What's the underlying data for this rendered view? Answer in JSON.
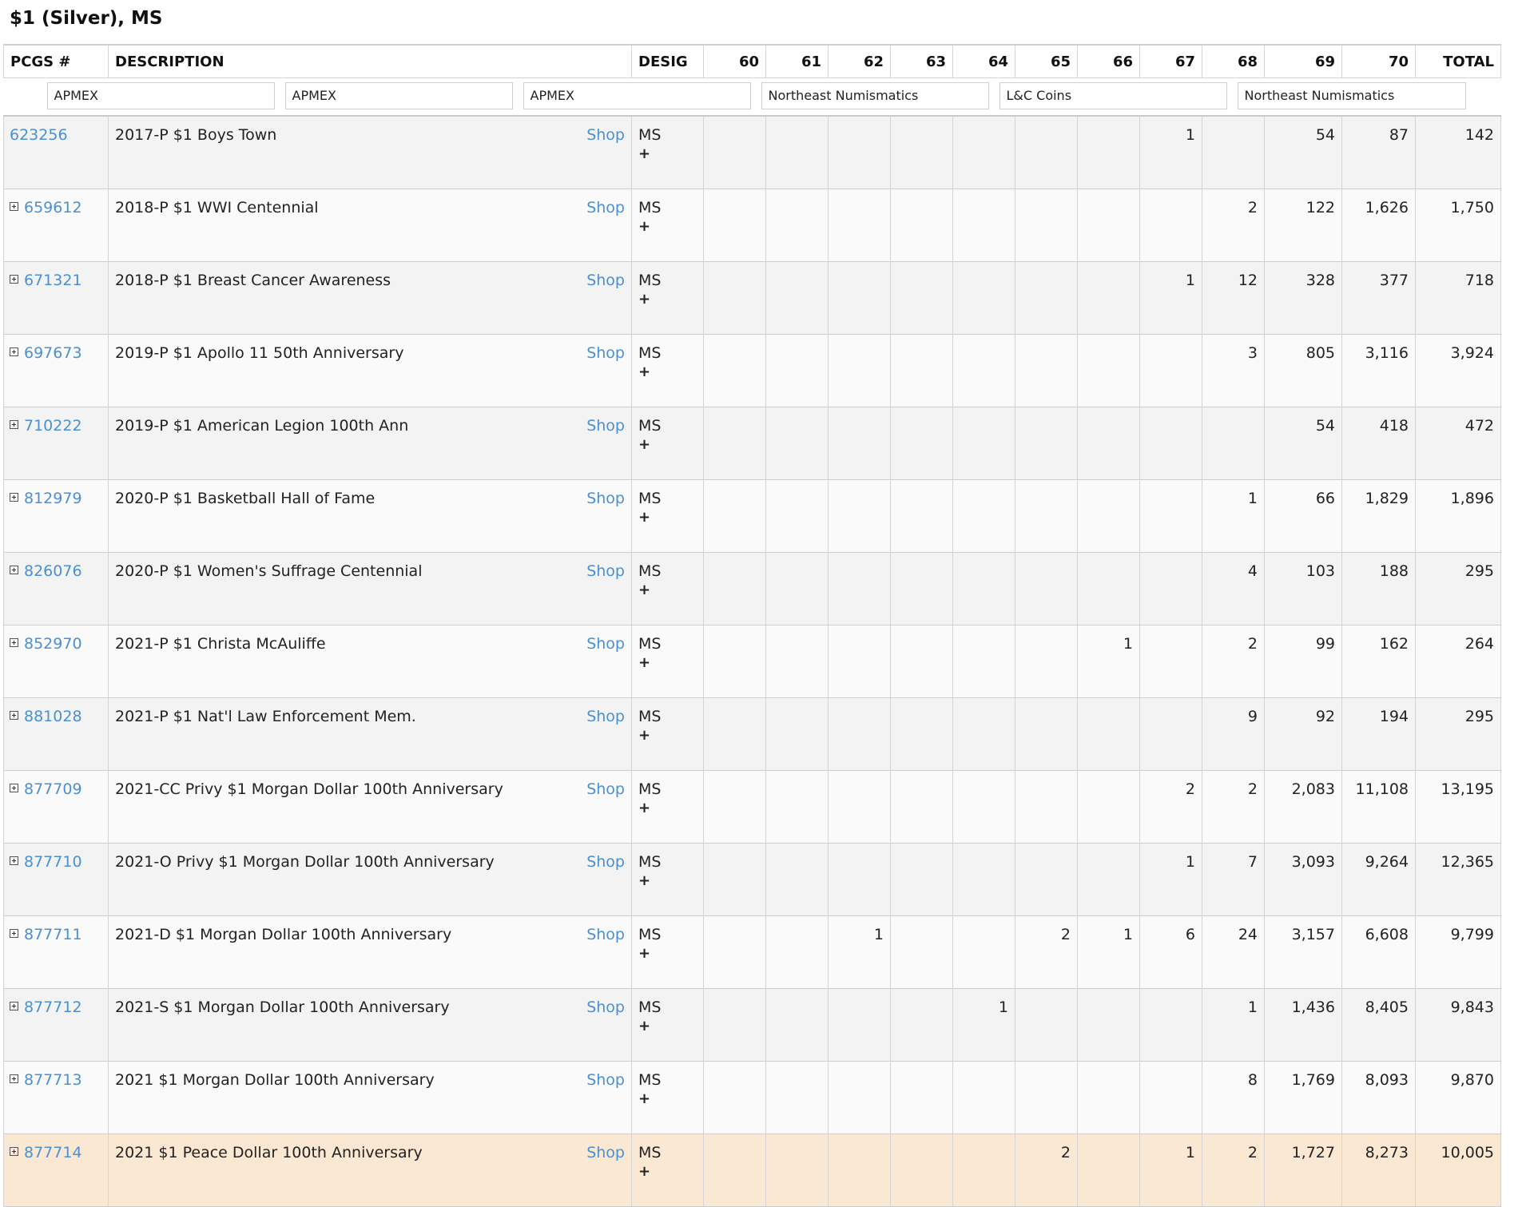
{
  "title": "$1 (Silver), MS",
  "headers": {
    "pcgs": "PCGS #",
    "description": "DESCRIPTION",
    "desig": "DESIG",
    "grades": [
      "60",
      "61",
      "62",
      "63",
      "64",
      "65",
      "66",
      "67",
      "68",
      "69",
      "70"
    ],
    "total": "TOTAL"
  },
  "ads": [
    "APMEX",
    "APMEX",
    "APMEX",
    "Northeast Numismatics",
    "L&C Coins",
    "Northeast Numismatics"
  ],
  "shop_label": "Shop",
  "plus_label": "+",
  "rows": [
    {
      "pcgs": "623256",
      "expand": false,
      "highlight": false,
      "desc": "2017-P $1 Boys Town",
      "desig": "MS",
      "grades": [
        "",
        "",
        "",
        "",
        "",
        "",
        "",
        "1",
        "",
        "54",
        "87"
      ],
      "total": "142"
    },
    {
      "pcgs": "659612",
      "expand": true,
      "highlight": false,
      "desc": "2018-P $1 WWI Centennial",
      "desig": "MS",
      "grades": [
        "",
        "",
        "",
        "",
        "",
        "",
        "",
        "",
        "2",
        "122",
        "1,626"
      ],
      "total": "1,750"
    },
    {
      "pcgs": "671321",
      "expand": true,
      "highlight": false,
      "desc": "2018-P $1 Breast Cancer Awareness",
      "desig": "MS",
      "grades": [
        "",
        "",
        "",
        "",
        "",
        "",
        "",
        "1",
        "12",
        "328",
        "377"
      ],
      "total": "718"
    },
    {
      "pcgs": "697673",
      "expand": true,
      "highlight": false,
      "desc": "2019-P $1 Apollo 11 50th Anniversary",
      "desig": "MS",
      "grades": [
        "",
        "",
        "",
        "",
        "",
        "",
        "",
        "",
        "3",
        "805",
        "3,116"
      ],
      "total": "3,924"
    },
    {
      "pcgs": "710222",
      "expand": true,
      "highlight": false,
      "desc": "2019-P $1 American Legion 100th Ann",
      "desig": "MS",
      "grades": [
        "",
        "",
        "",
        "",
        "",
        "",
        "",
        "",
        "",
        "54",
        "418"
      ],
      "total": "472"
    },
    {
      "pcgs": "812979",
      "expand": true,
      "highlight": false,
      "desc": "2020-P $1 Basketball Hall of Fame",
      "desig": "MS",
      "grades": [
        "",
        "",
        "",
        "",
        "",
        "",
        "",
        "",
        "1",
        "66",
        "1,829"
      ],
      "total": "1,896"
    },
    {
      "pcgs": "826076",
      "expand": true,
      "highlight": false,
      "desc": "2020-P $1 Women's Suffrage Centennial",
      "desig": "MS",
      "grades": [
        "",
        "",
        "",
        "",
        "",
        "",
        "",
        "",
        "4",
        "103",
        "188"
      ],
      "total": "295"
    },
    {
      "pcgs": "852970",
      "expand": true,
      "highlight": false,
      "desc": "2021-P $1 Christa McAuliffe",
      "desig": "MS",
      "grades": [
        "",
        "",
        "",
        "",
        "",
        "",
        "1",
        "",
        "2",
        "99",
        "162"
      ],
      "total": "264"
    },
    {
      "pcgs": "881028",
      "expand": true,
      "highlight": false,
      "desc": "2021-P $1 Nat'l Law Enforcement Mem.",
      "desig": "MS",
      "grades": [
        "",
        "",
        "",
        "",
        "",
        "",
        "",
        "",
        "9",
        "92",
        "194"
      ],
      "total": "295"
    },
    {
      "pcgs": "877709",
      "expand": true,
      "highlight": false,
      "desc": "2021-CC Privy $1 Morgan Dollar 100th Anniversary",
      "desig": "MS",
      "grades": [
        "",
        "",
        "",
        "",
        "",
        "",
        "",
        "2",
        "2",
        "2,083",
        "11,108"
      ],
      "total": "13,195"
    },
    {
      "pcgs": "877710",
      "expand": true,
      "highlight": false,
      "desc": "2021-O Privy $1 Morgan Dollar 100th Anniversary",
      "desig": "MS",
      "grades": [
        "",
        "",
        "",
        "",
        "",
        "",
        "",
        "1",
        "7",
        "3,093",
        "9,264"
      ],
      "total": "12,365"
    },
    {
      "pcgs": "877711",
      "expand": true,
      "highlight": false,
      "desc": "2021-D $1 Morgan Dollar 100th Anniversary",
      "desig": "MS",
      "grades": [
        "",
        "",
        "1",
        "",
        "",
        "2",
        "1",
        "6",
        "24",
        "3,157",
        "6,608"
      ],
      "total": "9,799"
    },
    {
      "pcgs": "877712",
      "expand": true,
      "highlight": false,
      "desc": "2021-S $1 Morgan Dollar 100th Anniversary",
      "desig": "MS",
      "grades": [
        "",
        "",
        "",
        "",
        "1",
        "",
        "",
        "",
        "1",
        "1,436",
        "8,405"
      ],
      "total": "9,843"
    },
    {
      "pcgs": "877713",
      "expand": true,
      "highlight": false,
      "desc": "2021 $1 Morgan Dollar 100th Anniversary",
      "desig": "MS",
      "grades": [
        "",
        "",
        "",
        "",
        "",
        "",
        "",
        "",
        "8",
        "1,769",
        "8,093"
      ],
      "total": "9,870"
    },
    {
      "pcgs": "877714",
      "expand": true,
      "highlight": true,
      "desc": "2021 $1 Peace Dollar 100th Anniversary",
      "desig": "MS",
      "grades": [
        "",
        "",
        "",
        "",
        "",
        "2",
        "",
        "1",
        "2",
        "1,727",
        "8,273"
      ],
      "total": "10,005"
    }
  ]
}
